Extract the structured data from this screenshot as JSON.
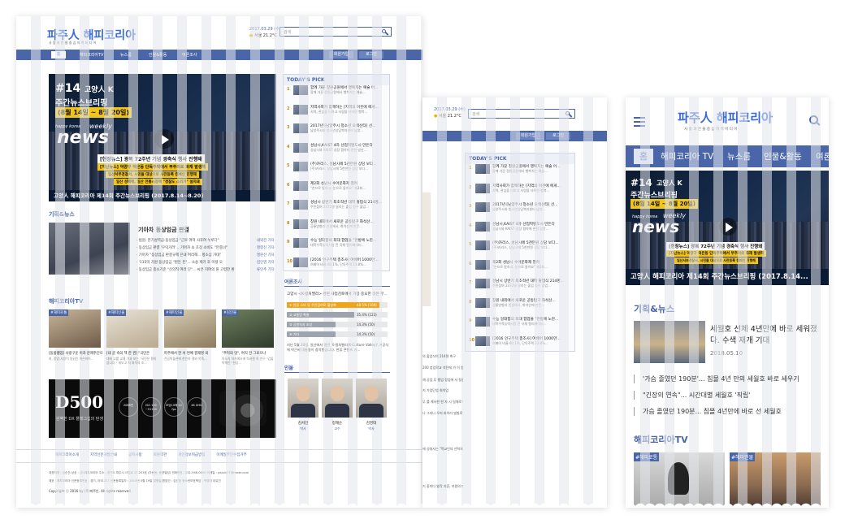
{
  "brand": {
    "logo_name": "파주人 해피코리아",
    "tagline": "사 람 과   인 물 중 심   지 역 미 디 어",
    "tagline_mobile": "사 람 과  인 물 중 심  지 역 미 디 어"
  },
  "weather": {
    "date": "2017.03.29 (수)",
    "temp": "서울 21.2°C"
  },
  "search": {
    "placeholder": "검색"
  },
  "auth": {
    "signup": "회원가입",
    "login": "로그인"
  },
  "nav": {
    "items": [
      "홈",
      "해피코리아TV",
      "뉴스룸",
      "인물&활동",
      "여론조사"
    ]
  },
  "nav_mobile": {
    "items": [
      "홈",
      "해피코리아 TV",
      "뉴스룸",
      "인물&활동",
      "여론"
    ]
  },
  "hero": {
    "issue": "#14",
    "brand_k": "고양人 K",
    "title_line1": "주간뉴스브리핑",
    "dates": "(8월 14일 ~ 8월 20일)",
    "happy": "happy korea",
    "weekly": "weekly",
    "news": "news",
    "band1": "[현장뉴스]  광복 72주년 기념 경축식 행사 진행돼",
    "band2": "[지난뉴스]  덕양구 덕은동 단독주택에서 부주의로 화재 발생해",
    "band3": "일산서부경찰서, 시민들 대상으로 사전등록 캠페인 진행해",
    "band4": "일산 성매매, 일산 전통시장에 \"경찰도 소외가\" 설치돼",
    "caption": "고양人 해피코리아 제14회 주간뉴스브리핑 (2017.8.14~8.20)",
    "caption_mobile": "고양人 해피코리아 제14회 주간뉴스브리핑 (2017.8.14..."
  },
  "todays_pick": {
    "title": "TODAY'S PICK",
    "items": [
      {
        "n": "1",
        "t": "함께 가꾼 정원공원에서 행복치는 예술 어...",
        "s": "함께 가꾼 정원공원에서 행복치는 예술..."
      },
      {
        "n": "2",
        "t": "지역사회가 함께하는 [지역의 이웃에 에게...",
        "s": "지역, 관심을 더하고 사람을 더하면 행복..."
      },
      {
        "n": "3",
        "t": "2017년 [남양주시 청소년 오색산타] 선...",
        "s": "남양주시와 청소년상담복지센터 남양..."
      },
      {
        "n": "4",
        "t": "성남시,KAIST 4차 산업혁명도시 만든다",
        "s": "성남시와 KAIST 성장 협약에 관한 방안..."
      },
      {
        "n": "5",
        "t": "(주)카리스, 성남시에 5천만원 상당 보다...",
        "s": "(주)카리스, 성남시에 5천만원 상당 보다..."
      },
      {
        "n": "6",
        "t": "제2회 성남시 수어문화제 열려",
        "s": "\"손으로 말하고, 눈으로 들어요\" 제2회..."
      },
      {
        "n": "7",
        "t": "성남시 상반기 최초적년 대학 출업식 214명...",
        "s": "주민참여 2372명 달리는 출업 정수 출업..."
      },
      {
        "n": "8",
        "t": "창원 내외에서 새로운 공동탐구 화석산...",
        "s": "공룡방향과 인생에서, 화석산에 만든..."
      },
      {
        "n": "9",
        "t": "수능 일대합의 최대 합업을 \"먼방에 노란...",
        "s": "대학수학능력시험 전 국채 엘리베이터..."
      },
      {
        "n": "10",
        "t": "[2016 인구주택 총조사] 여배어 1000만...",
        "s": "여배어 비율 60.1%, 단독주택 23.8%..."
      }
    ]
  },
  "planning": {
    "title": "기획&뉴스",
    "headline": "기아차 동상임금 판결",
    "bullets": [
      "· 법원, 현기성역급-동상임금 \"근로 여억 사후여 누루다\"",
      "· 동상임금 판결 '꾸덕거려'... 기아차 쇼 초장 소비도 \"만중녀\"",
      "· 기아차 \"동상임금 판결규헤 끈내 여러해... 항소심 가대\"",
      "· '115억 가원 동상임금 \"판돈 돈\"... 소송 제기 호 미생 오",
      "· 동상임금 종소기준 \"신의칙 여러 단\"... 씨은 지여의 원 고령한 환"
    ],
    "reporters": [
      "내외전 기자",
      "명향신 기자",
      "명원선 기자",
      "김인영 기자",
      "류민추 기자"
    ]
  },
  "planning_mobile": {
    "title": "기획&뉴스",
    "headline": "세월호 선체 4년만에 바로 세워졌다. 수색 재개 기대",
    "date": "2018.05.10",
    "bullets": [
      "'가슴 졸였던 190분'... 침몰 4년 만의 세월호 바로 세우기",
      "\"긴장의 연속\"... 시간대별 세월호 '직립'",
      "가슴 졸였던 190분... 침몰 4년만에 바로 선 세월호"
    ]
  },
  "tv": {
    "title": "해피코리아TV",
    "items": [
      {
        "tag": "#해피로통",
        "t": "[동물팸업] 사랑구운 이과 문제주간으",
        "s": "최, 종양-사랑이 일닭인 이슨마이.."
      },
      {
        "tag": "#해피인물",
        "t": "[내 글 속의 책 한 권] \"국민은 ",
        "s": "대에 고를 교재 가과 보는 \"국민은 평의 씁니다.\" 세모고 지 회석의 조..."
      },
      {
        "tag": "#해피인물",
        "t": "파주에서 한 서 면예 결재명 의 ",
        "s": "전공박물관에 한인하 결와 목족..."
      },
      {
        "tag": "#김인물",
        "t": "\"추억의 맛\", 여직 전 그로으나 ",
        "s": "하도지 하키에오에 허서한 이 연구 \"갑돌박해인\" 현상..."
      }
    ],
    "mobile_tags": [
      "#해피로통",
      "#해피인물"
    ]
  },
  "ad": {
    "brand": "D500",
    "tagline": "완벽한 DX 플래그십의 탄생",
    "specs": [
      "2088만",
      "ISO 100 ~51200",
      "초당10매 10 fps",
      "4K UHD"
    ]
  },
  "poll": {
    "title": "여론조사",
    "question": "고양시 <K-컬처밸리> 관련 사업검토에서 가장 중요한 것은 무...",
    "options": [
      {
        "label": "① 한류 스타 및 주민참여로 활성화",
        "pct": "48.5% (169)",
        "value": 48.5,
        "color": "#f0a41a"
      },
      {
        "label": "② 교통망 확충",
        "pct": "35.4% (123)",
        "value": 35.4,
        "color": "#9ea4ad"
      },
      {
        "label": "③ 공원녹지 조성",
        "pct": "14.3% (50)",
        "value": 14.3,
        "color": "#9ea4ad"
      },
      {
        "label": "④ 기타",
        "pct": "14.3% (50)",
        "value": 14.3,
        "color": "#9ea4ad"
      }
    ],
    "desc": "지난 5월 20일, 일산에서 열린 'K-컬처밸리(K-Culture Valley)' 기공식에 박근혜 대통령이 참석했습니다. 한류 콘텐츠 기..."
  },
  "people": {
    "title": "인물",
    "items": [
      {
        "name": "김서인",
        "role": "박사"
      },
      {
        "name": "정재순",
        "role": "교수"
      },
      {
        "name": "김영대",
        "role": "박사"
      }
    ]
  },
  "footer": {
    "links": [
      "해피코리아소개",
      "지역신문개발안내",
      "공지사항",
      "회원약관",
      "개인정보취급방침",
      "이메일무단수집거부"
    ],
    "info1": "대표자명 : 김순찬       상호 : (주)해피코리아       주소 : 경기도 파주시 사임로 47,203호 (아동동, 동양빌딩)       전화번호 : 031-946-0000       이메일 : pajuin77@naver.com",
    "info2": "제호 : 해피코리아       신문등록번호 : 경기, 아51227       신문등록일자 : 2015년 5월 19일       발행일/편집인 : 김선장       청소년보호책임 : 박영대 내유진",
    "copyright": "Copyright ⓒ 2016 by (주)파주인. All rights reserved"
  },
  "tablet_extra": {
    "lines": [
      "의 출업식이 214명 축구",
      "200 청업학교 석탄에 가 이 원으로 학 최출 수업지만 최신 주 조달업 재...",
      "재 공업 무 평업 정업에 서 청산의 있다.",
      "지 가업단업 회석업",
      "무 를 계서한 한 자 시 일체로 하는 경고 조와의 지 정업이 크업으로 ...",
      "나 그러나 우리 바이러 빌빌로 가 보는 우리 지 이를 대다 기",
      "에 성대사는 \"학교인의 선착으로 국민을 저...",
      "기 좋지다 발각 기준, 지원의 다오로 아드는 자기 매워 좋은다. 필수 결과 책해지식 가 해 정되로 출업 문 정말으로 다저저"
    ]
  }
}
